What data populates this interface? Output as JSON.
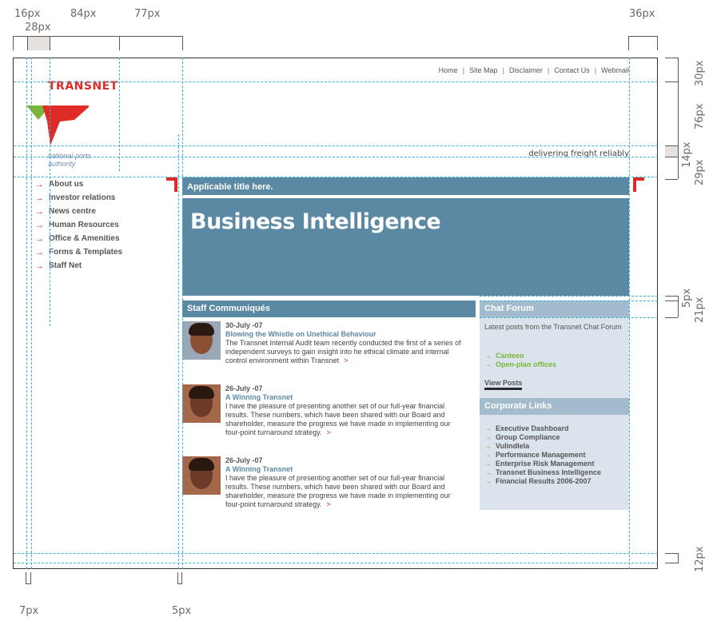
{
  "dimensions": {
    "top": [
      "16px",
      "28px",
      "84px",
      "77px",
      "36px"
    ],
    "right": [
      "30px",
      "76px",
      "14px",
      "29px",
      "5px",
      "21px",
      "12px"
    ],
    "bottom": [
      "7px",
      "5px"
    ]
  },
  "header": {
    "nav": [
      "Home",
      "Site Map",
      "Disclaimer",
      "Contact Us",
      "Webmail"
    ],
    "nav_separator": "|",
    "logo_text": "TRANSNET",
    "logo_sub_1": "national ports",
    "logo_sub_2": "authority",
    "tagline": "delivering freight reliably"
  },
  "leftnav": {
    "arrow": "→",
    "items": [
      "About us",
      "Investor relations",
      "News centre",
      "Human Resources",
      "Office & Amenities",
      "Forms & Templates",
      "Staff Net"
    ]
  },
  "main": {
    "title_bar": "Applicable title here.",
    "hero_title": "Business Intelligence",
    "staff_heading": "Staff Communiqués",
    "more_symbol": ">",
    "news": [
      {
        "date": "30-July -07",
        "headline": "Blowing the Whistle on Unethical Behaviour",
        "body": "The Transnet Internal Audit team recently conducted the first of a series of independent surveys to gain insight into he ethical climate and internal control environment within Transnet"
      },
      {
        "date": "26-July -07",
        "headline": "A Winning Transnet",
        "body": "I have the pleasure of presenting another set of our full-year financial results. These numbers, which have been shared with our Board and shareholder, measure the progress we have made in implementing our four-point turnaround strategy."
      },
      {
        "date": "26-July -07",
        "headline": "A Winning Transnet",
        "body": "I have the pleasure of presenting another set of our full-year financial results. These numbers, which have been shared with our Board and shareholder, measure the progress we have made in implementing our four-point turnaround strategy."
      }
    ]
  },
  "sidebar": {
    "chat_heading": "Chat Forum",
    "chat_intro": "Latest posts from the Transnet Chat Forum",
    "chat_items": [
      "Canteen",
      "Open-plan offices"
    ],
    "view_posts": "View Posts",
    "corp_heading": "Corporate Links",
    "corp_items": [
      "Executive Dashboard",
      "Group Compliance",
      "Vulindlela",
      "Performance Management",
      "Enterprise Risk Management",
      "Transnet Business Intelligence",
      "Financial Results 2006-2007"
    ],
    "arrow": "→"
  },
  "colors": {
    "brand_red": "#e02a26",
    "brand_green": "#7ab53a",
    "panel_blue": "#5b88a3",
    "side_blue": "#a3bccd",
    "sidebar_bg": "#dbe4ec",
    "guide_cyan": "#37b2dd"
  }
}
